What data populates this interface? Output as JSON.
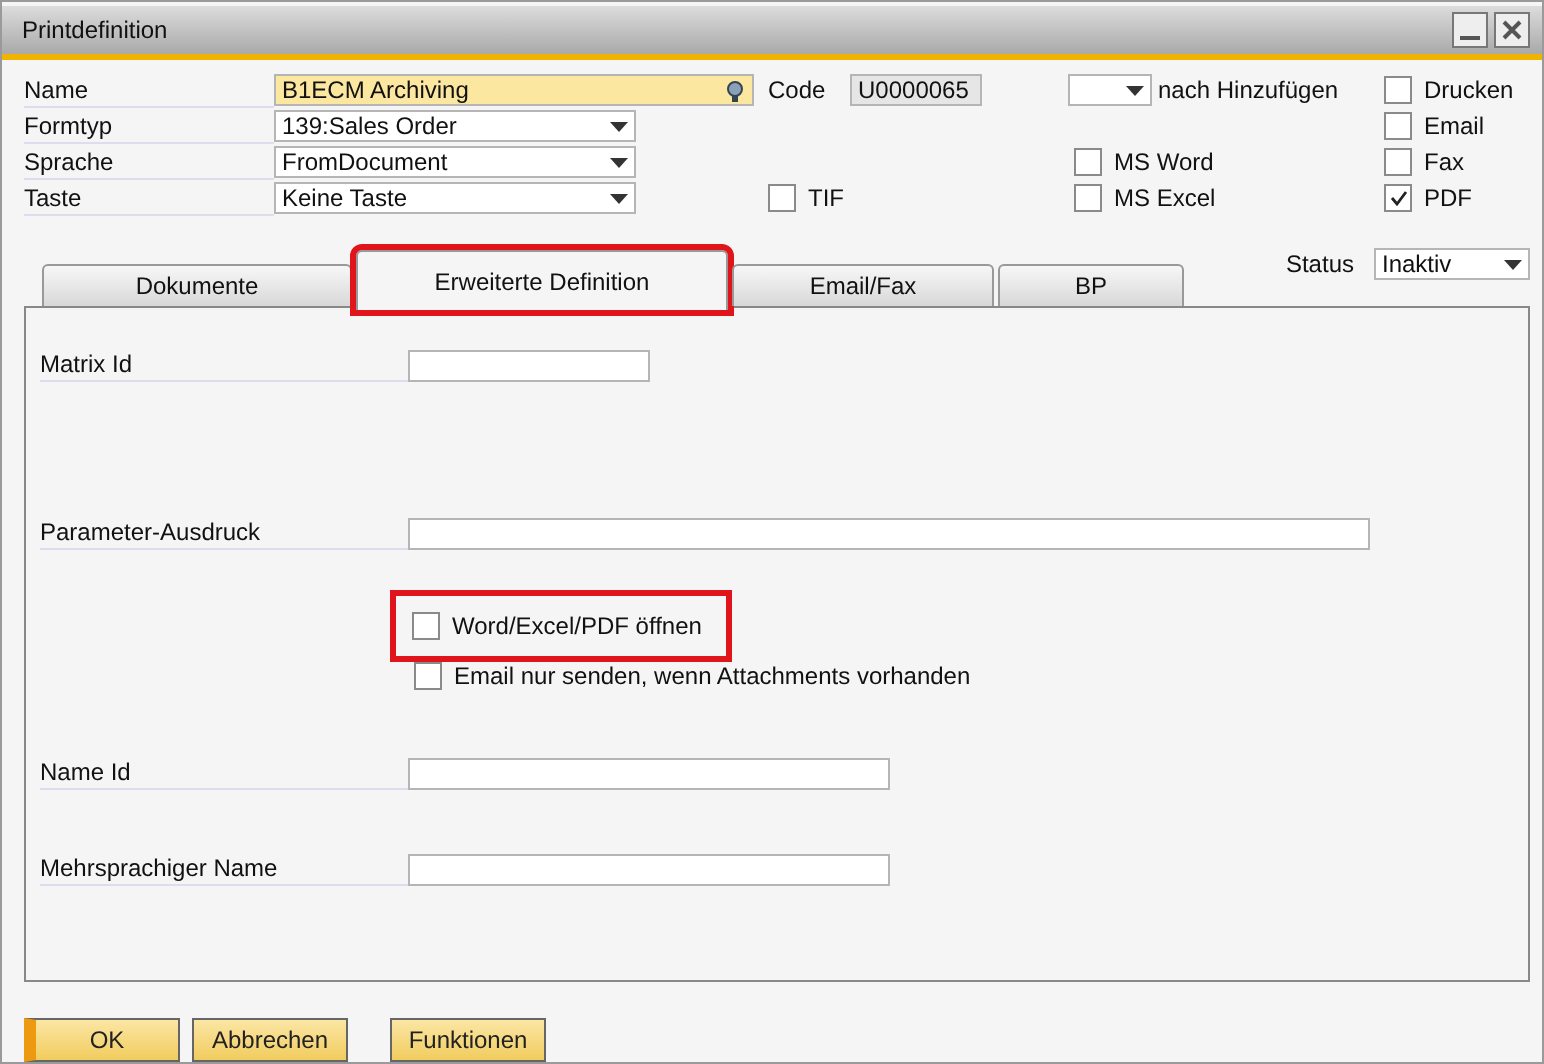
{
  "window": {
    "title": "Printdefinition"
  },
  "name": {
    "label": "Name",
    "value": "B1ECM Archiving"
  },
  "code": {
    "label": "Code",
    "value": "U0000065"
  },
  "after_add": {
    "label": "nach Hinzufügen"
  },
  "selects": [
    {
      "label": "Formtyp",
      "value": "139:Sales Order"
    },
    {
      "label": "Sprache",
      "value": "FromDocument"
    },
    {
      "label": "Taste",
      "value": "Keine Taste"
    }
  ],
  "tif": {
    "label": "TIF",
    "checked": false
  },
  "formats": [
    {
      "label": "MS Word",
      "checked": false
    },
    {
      "label": "MS Excel",
      "checked": false
    }
  ],
  "outputs": [
    {
      "label": "Drucken",
      "checked": false
    },
    {
      "label": "Email",
      "checked": false
    },
    {
      "label": "Fax",
      "checked": false
    },
    {
      "label": "PDF",
      "checked": true
    }
  ],
  "tabs": [
    {
      "label": "Dokumente",
      "selected": false,
      "highlighted": false
    },
    {
      "label": "Erweiterte Definition",
      "selected": true,
      "highlighted": true
    },
    {
      "label": "Email/Fax",
      "selected": false,
      "highlighted": false
    },
    {
      "label": "BP",
      "selected": false,
      "highlighted": false
    }
  ],
  "status": {
    "label": "Status",
    "value": "Inaktiv"
  },
  "panel": {
    "items": [
      {
        "kind": "field",
        "label": "Matrix Id"
      },
      {
        "kind": "field",
        "label": "Parameter-Ausdruck"
      },
      {
        "kind": "checkbox",
        "label": "Word/Excel/PDF öffnen",
        "checked": false,
        "highlighted": true
      },
      {
        "kind": "checkbox",
        "label": "Email nur senden, wenn Attachments vorhanden",
        "checked": false,
        "highlighted": false
      },
      {
        "kind": "field",
        "label": "Name Id"
      },
      {
        "kind": "field",
        "label": "Mehrsprachiger Name"
      }
    ]
  },
  "buttons": [
    {
      "label": "OK",
      "kind": "default"
    },
    {
      "label": "Abbrechen",
      "kind": "normal"
    },
    {
      "label": "Funktionen",
      "kind": "normal"
    }
  ]
}
